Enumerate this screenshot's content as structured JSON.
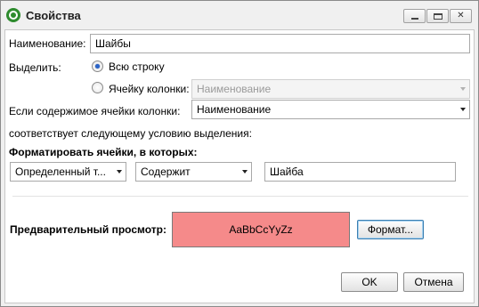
{
  "window": {
    "title": "Свойства",
    "controls": {
      "minimize": "minimize",
      "maximize": "maximize",
      "close": "✕"
    }
  },
  "form": {
    "name_label": "Наименование:",
    "name_value": "Шайбы",
    "highlight_label": "Выделить:",
    "option_whole_row": "Всю строку",
    "option_column_cell": "Ячейку колонки:",
    "column_cell_value": "Наименование",
    "cell_contents_label": "Если содержимое ячейки колонки:",
    "cell_contents_value": "Наименование",
    "condition_text": "соответствует следующему условию выделения:",
    "format_cells_heading": "Форматировать ячейки, в которых:",
    "condition_type_value": "Определенный т...",
    "operator_value": "Содержит",
    "match_value": "Шайба"
  },
  "preview": {
    "label": "Предварительный просмотр:",
    "sample_text": "AaBbCcYyZz",
    "format_button": "Формат..."
  },
  "footer": {
    "ok_button": "OK",
    "cancel_button": "Отмена"
  },
  "state": {
    "selected_highlight_option": "Всю строку"
  },
  "colors": {
    "preview_background": "#f58a8a",
    "radio_selected": "#2a64c8",
    "app_icon": "#2e8b2e"
  },
  "icons": {
    "app": "app-logo-icon",
    "minimize": "minimize-icon",
    "maximize": "maximize-icon",
    "close": "close-icon",
    "dropdown": "chevron-down-icon"
  }
}
